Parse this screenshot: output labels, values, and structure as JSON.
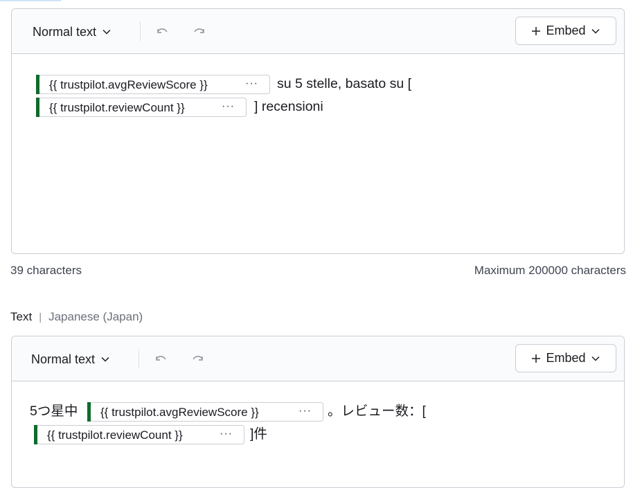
{
  "editor_top": {
    "toolbar": {
      "format_label": "Normal text",
      "embed_label": "Embed"
    },
    "line1": {
      "chip": "{{ trustpilot.avgReviewScore }}",
      "text": "su 5 stelle, basato su ["
    },
    "line2": {
      "chip": "{{ trustpilot.reviewCount }}",
      "text": "] recensioni"
    },
    "char_count": "39 characters",
    "max_chars": "Maximum 200000 characters"
  },
  "section": {
    "label": "Text",
    "separator": "|",
    "language": "Japanese (Japan)"
  },
  "editor_bottom": {
    "toolbar": {
      "format_label": "Normal text",
      "embed_label": "Embed"
    },
    "line1": {
      "prefix": "5つ星中",
      "chip": "{{ trustpilot.avgReviewScore }}",
      "text": "。レビュー数：["
    },
    "line2": {
      "chip": "{{ trustpilot.reviewCount }}",
      "text": "]件"
    }
  },
  "chip_menu_glyph": "···",
  "colors": {
    "accent_bar": "#0e6b2b",
    "border": "#c9cdd4",
    "muted_text": "#3f4450"
  },
  "icons": [
    "chevron-down-icon",
    "undo-icon",
    "redo-icon",
    "plus-icon"
  ]
}
